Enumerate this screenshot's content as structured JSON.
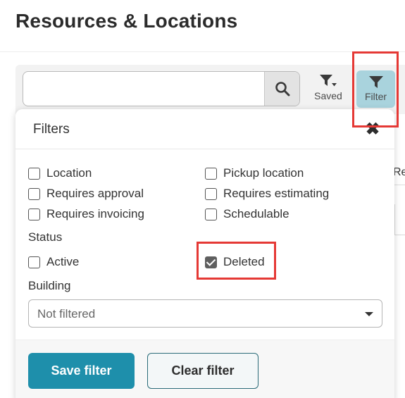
{
  "page": {
    "title": "Resources & Locations"
  },
  "toolbar": {
    "search_value": "",
    "saved_label": "Saved",
    "filter_label": "Filter"
  },
  "background": {
    "column_header_partial": "Re"
  },
  "filters_panel": {
    "title": "Filters",
    "close_icon": "close-icon",
    "options_left": [
      {
        "label": "Location",
        "checked": false
      },
      {
        "label": "Requires approval",
        "checked": false
      },
      {
        "label": "Requires invoicing",
        "checked": false
      }
    ],
    "options_right": [
      {
        "label": "Pickup location",
        "checked": false
      },
      {
        "label": "Requires estimating",
        "checked": false
      },
      {
        "label": "Schedulable",
        "checked": false
      }
    ],
    "status": {
      "label": "Status",
      "options": [
        {
          "label": "Active",
          "checked": false
        },
        {
          "label": "Deleted",
          "checked": true
        }
      ]
    },
    "building": {
      "label": "Building",
      "selected": "Not filtered"
    },
    "save_label": "Save filter",
    "clear_label": "Clear filter"
  },
  "colors": {
    "accent": "#1e8fab",
    "filter_active_bg": "#a9d3dd",
    "highlight": "#e53935"
  }
}
